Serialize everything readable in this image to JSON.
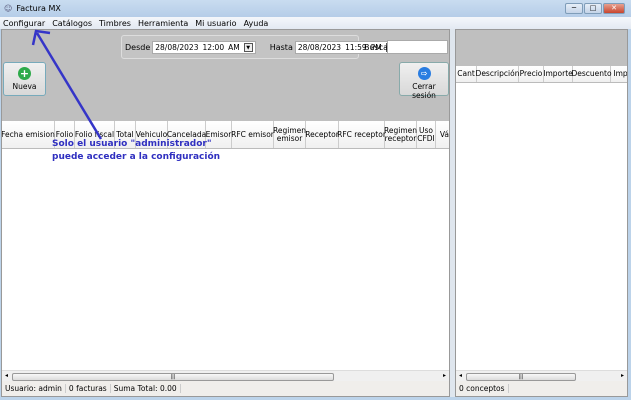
{
  "window": {
    "title": "Factura MX",
    "minimize": "─",
    "maximize": "□",
    "close": "✕"
  },
  "menu": [
    "Configurar",
    "Catálogos",
    "Timbres",
    "Herramienta",
    "Mi usuario",
    "Ayuda"
  ],
  "filters": {
    "desde_label": "Desde",
    "desde_date": "28/08/2023",
    "desde_time": "12:00",
    "desde_ampm": "AM",
    "hasta_label": "Hasta",
    "hasta_date": "28/08/2023",
    "hasta_time": "11:59",
    "hasta_ampm": "PM",
    "buscar_label": "Buscar",
    "buscar_value": ""
  },
  "buttons": {
    "nueva": "Nueva",
    "cerrar_sesion": "Cerrar sesión"
  },
  "facturas_columns": [
    "Fecha emision",
    "Folio",
    "Folio fiscal",
    "Total",
    "Vehiculo",
    "Cancelada",
    "Emisor",
    "RFC emisor",
    "Regimen emisor",
    "Receptor",
    "RFC receptor",
    "Regimen receptor",
    "Uso CFDI",
    "Vál"
  ],
  "conceptos_columns": [
    "Cant",
    "Descripción",
    "Precio",
    "Importe",
    "Descuento",
    "Imp"
  ],
  "status_left": {
    "usuario": "Usuario: admin",
    "facturas": "0 facturas",
    "suma": "Suma Total: 0.00"
  },
  "status_right": {
    "conceptos": "0 conceptos"
  },
  "annotation": {
    "line1": "Solo el usuario \"administrador\"",
    "line2": "puede acceder a la configuración",
    "color": "#2f2fc0"
  },
  "colors": {
    "nueva_icon": "#2eaa4a",
    "cerrar_icon": "#2a7de1"
  }
}
